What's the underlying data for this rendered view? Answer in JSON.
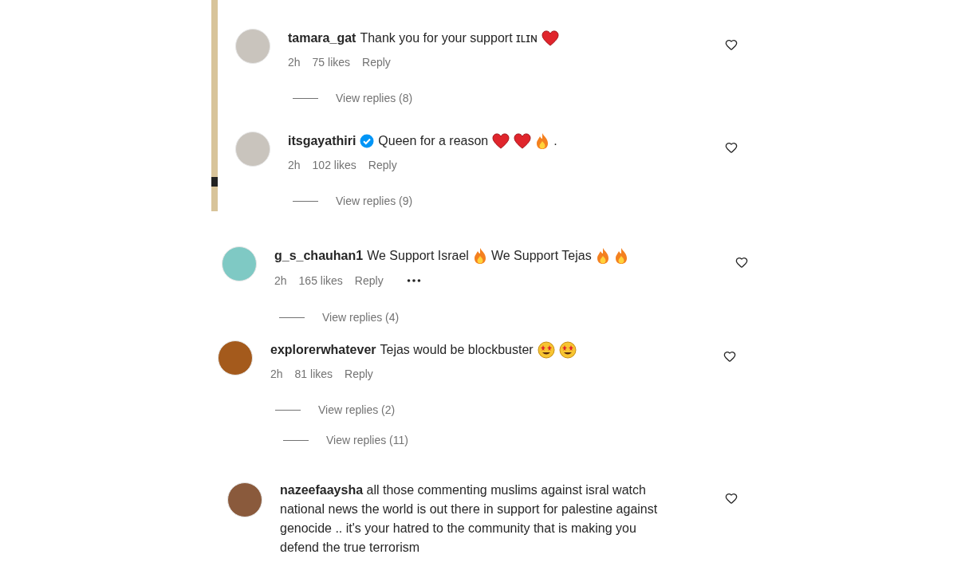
{
  "panels": [
    {
      "items": [
        {
          "kind": "comment",
          "username": "tamara_gat",
          "verified": false,
          "body": [
            {
              "kind": "text",
              "text": "Thank you for your support ɪʟɪɴ"
            },
            {
              "kind": "heart"
            }
          ],
          "time": "2h",
          "likes": "75 likes",
          "reply": "Reply",
          "more": false
        },
        {
          "kind": "replies",
          "label": "View replies (8)"
        },
        {
          "kind": "comment",
          "username": "itsgayathiri",
          "verified": true,
          "body": [
            {
              "kind": "text",
              "text": "Queen for a reason"
            },
            {
              "kind": "heart"
            },
            {
              "kind": "heart"
            },
            {
              "kind": "fire"
            },
            {
              "kind": "text",
              "text": "."
            }
          ],
          "time": "2h",
          "likes": "102 likes",
          "reply": "Reply",
          "more": false
        },
        {
          "kind": "replies",
          "label": "View replies (9)"
        }
      ]
    },
    {
      "items": [
        {
          "kind": "comment",
          "username": "g_s_chauhan1",
          "verified": false,
          "body": [
            {
              "kind": "text",
              "text": "We Support Israel"
            },
            {
              "kind": "fire"
            },
            {
              "kind": "text",
              "text": "We Support Tejas"
            },
            {
              "kind": "fire"
            },
            {
              "kind": "fire"
            }
          ],
          "time": "2h",
          "likes": "165 likes",
          "reply": "Reply",
          "more": true
        },
        {
          "kind": "replies",
          "label": "View replies (4)"
        }
      ]
    },
    {
      "items": [
        {
          "kind": "comment",
          "username": "explorerwhatever",
          "verified": false,
          "body": [
            {
              "kind": "text",
              "text": "Tejas would be blockbuster"
            },
            {
              "kind": "star_eyes"
            },
            {
              "kind": "star_eyes"
            }
          ],
          "time": "2h",
          "likes": "81 likes",
          "reply": "Reply",
          "more": false
        },
        {
          "kind": "replies",
          "label": "View replies (2)"
        },
        {
          "kind": "replies",
          "label": "View replies (11)"
        }
      ]
    },
    {
      "items": [
        {
          "kind": "comment",
          "username": "nazeefaaysha",
          "verified": false,
          "body": [
            {
              "kind": "text",
              "text": "all those commenting muslims against isral watch national news the world is out there in support for palestine against genocide .. it's your hatred to the community that is making you defend the true terrorism"
            }
          ]
        }
      ]
    }
  ]
}
